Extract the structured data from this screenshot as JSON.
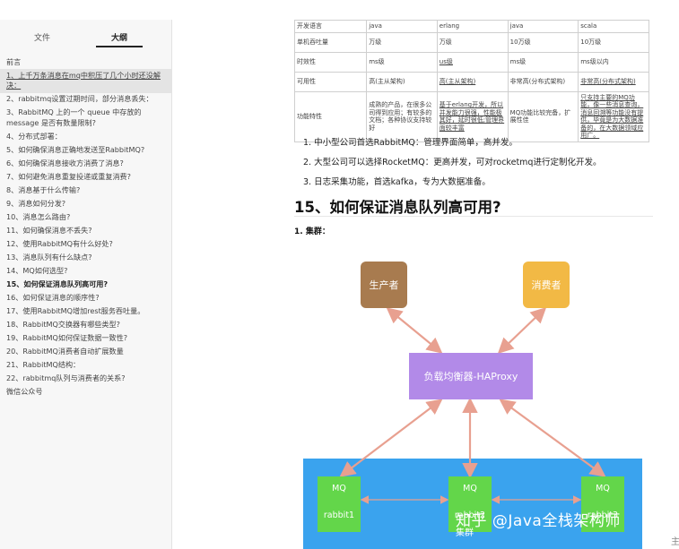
{
  "sidebar": {
    "tabs": [
      {
        "label": "文件"
      },
      {
        "label": "大纲"
      }
    ],
    "outline": [
      "前言",
      "1、上千万条消息在mq中积压了几个小时还没解决：",
      "2、rabbitmq设置过期时间，部分消息丢失：",
      "3、RabbitMQ 上的一个 queue 中存放的 message 是否有数量限制?",
      "4、分布式部署：",
      "5、如何确保消息正确地发送至RabbitMQ?",
      "6、如何确保消息接收方消费了消息?",
      "7、如何避免消息重复投递或重复消费?",
      "8、消息基于什么传输?",
      "9、消息如何分发?",
      "10、消息怎么路由?",
      "11、如何确保消息不丢失?",
      "12、使用RabbitMQ有什么好处?",
      "13、消息队列有什么缺点?",
      "14、MQ如何选型?",
      "15、如何保证消息队列高可用?",
      "16、如何保证消息的顺序性?",
      "17、使用RabbitMQ增加rest服务吞吐量。",
      "18、RabbitMQ交换器有哪些类型?",
      "19、RabbitMQ如何保证数据一致性?",
      "20、RabbitMQ消费者自动扩展数量",
      "21、RabbitMQ结构：",
      "22、rabbitmq队列与消费者的关系?",
      "微信公众号"
    ]
  },
  "table": {
    "rows": [
      [
        "开发语言",
        "java",
        "erlang",
        "java",
        "scala"
      ],
      [
        "单机吞吐量",
        "万级",
        "万级",
        "10万级",
        "10万级"
      ],
      [
        "时效性",
        "ms级",
        "us级",
        "ms级",
        "ms级以内"
      ],
      [
        "可用性",
        "高(主从架构)",
        "高(主从架构)",
        "非常高(分布式架构)",
        "非常高(分布式架构)"
      ],
      [
        "功能特性",
        "成熟的产品，在很多公司得到应用；有较多的文档；各种协议支持较好",
        "基于erlang开发，所以并发能力很强，性能极其好，延时很低;管理界面较丰富",
        "MQ功能比较完备，扩展性佳",
        "只支持主要的MQ功能，像一些消息查询，消息回溯等功能没有提供，毕竟是为大数据准备的，在大数据领域应用广。"
      ]
    ]
  },
  "list": [
    "1. 中小型公司首选RabbitMQ：管理界面简单，高并发。",
    "2. 大型公司可以选择RocketMQ：更高并发，可对rocketmq进行定制化开发。",
    "3. 日志采集功能，首选kafka，专为大数据准备。"
  ],
  "heading": "15、如何保证消息队列高可用?",
  "subheading": "1. 集群：",
  "diagram": {
    "producer": "生产者",
    "consumer": "消费者",
    "haproxy": "负载均衡器-HAProxy",
    "mq_label": "MQ",
    "nodes": [
      "rabbit1",
      "rabbit2",
      "rabbit3"
    ],
    "cluster_label": "集群",
    "colors": {
      "producer": "#a87b4f",
      "consumer": "#f2b945",
      "haproxy": "#b28ae8",
      "cluster": "#3aa3ee",
      "mq": "#63d64a",
      "arrow": "#e8a090"
    }
  },
  "watermark": "知乎 @Java全栈架构师",
  "right_mark": "主"
}
